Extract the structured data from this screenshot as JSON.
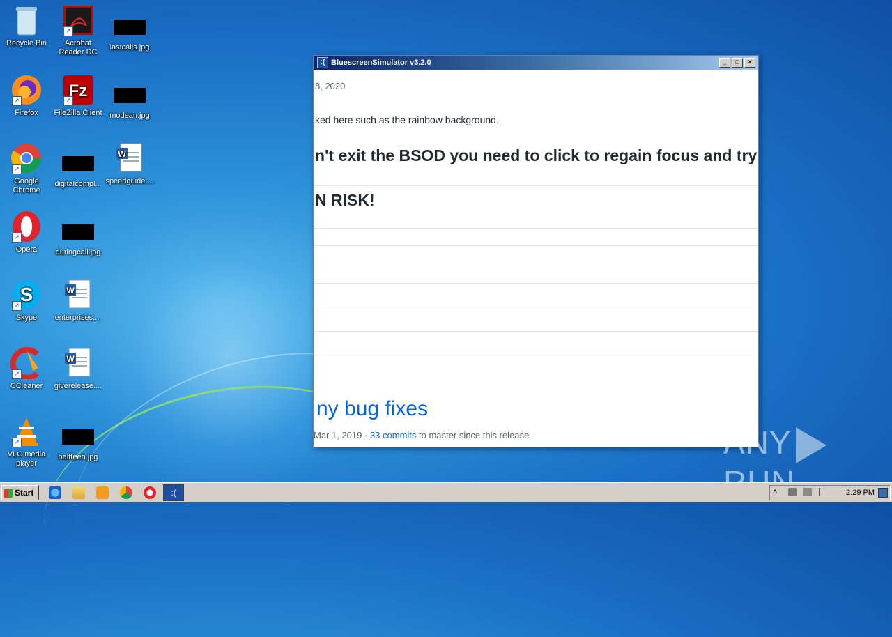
{
  "desktop": {
    "icons": [
      {
        "label": "Recycle Bin"
      },
      {
        "label": "Acrobat Reader DC"
      },
      {
        "label": "lastcalls.jpg"
      },
      {
        "label": "Firefox"
      },
      {
        "label": "FileZilla Client"
      },
      {
        "label": "modean.jpg"
      },
      {
        "label": "Google Chrome"
      },
      {
        "label": "digitalcompl..."
      },
      {
        "label": "speedguide...."
      },
      {
        "label": "Opera"
      },
      {
        "label": "duringcall.jpg"
      },
      {
        "label": "Skype"
      },
      {
        "label": "enterprises...."
      },
      {
        "label": "CCleaner"
      },
      {
        "label": "giverelease...."
      },
      {
        "label": "VLC media player"
      },
      {
        "label": "halfteen.jpg"
      }
    ]
  },
  "window": {
    "title": "BluescreenSimulator v3.2.0",
    "app_icon": ":(",
    "content": {
      "date": "8, 2020",
      "rainbow_text": "ked here such as the rainbow background.",
      "bsod_text": "n't exit the BSOD you need to click to regain focus and try",
      "risk_text": "N RISK!",
      "heading": "ny bug fixes",
      "meta_prefix": "Mar 1, 2019 · ",
      "meta_link": "33 commits",
      "meta_suffix": " to master since this release"
    }
  },
  "watermark": {
    "left": "ANY",
    "right": "RUN"
  },
  "taskbar": {
    "start_label": "Start",
    "active_app_icon": ":(",
    "clock": "2:29 PM"
  }
}
